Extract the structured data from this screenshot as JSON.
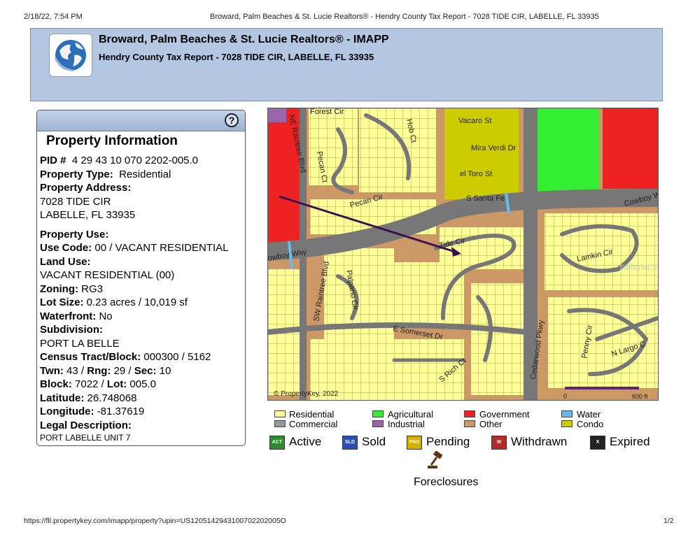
{
  "print_header": {
    "datetime": "2/18/22, 7:54 PM",
    "page_title": "Broward, Palm Beaches & St. Lucie Realtors® - Hendry County Tax Report - 7028 TIDE CIR, LABELLE, FL 33935"
  },
  "banner": {
    "title": "Broward, Palm Beaches & St. Lucie Realtors® - IMAPP",
    "subtitle": "Hendry County Tax Report - 7028 TIDE CIR, LABELLE, FL 33935",
    "background": "#b3c6e2"
  },
  "panel": {
    "help_icon": "?",
    "title": "Property Information",
    "pid_label": "PID #",
    "pid_value": "4 29 43 10 070 2202-005.0",
    "property_type_label": "Property Type:",
    "property_type_value": "Residential",
    "address_label": "Property Address:",
    "address_line1": "7028 TIDE CIR",
    "address_line2": "LABELLE, FL 33935",
    "use_label": "Property Use:",
    "use_code_label": "Use Code:",
    "use_code_value": "00 / VACANT RESIDENTIAL",
    "land_use_label": "Land Use:",
    "land_use_value": "VACANT RESIDENTIAL (00)",
    "zoning_label": "Zoning:",
    "zoning_value": "RG3",
    "lot_size_label": "Lot Size:",
    "lot_size_value": "0.23 acres / 10,019 sf",
    "waterfront_label": "Waterfront:",
    "waterfront_value": "No",
    "subdivision_label": "Subdivision:",
    "subdivision_value": "PORT LA BELLE",
    "census_label": "Census Tract/Block:",
    "census_value": "000300 / 5162",
    "twn_label": "Twn:",
    "twn_value": "43",
    "rng_label": "Rng:",
    "rng_value": "29",
    "sec_label": "Sec:",
    "sec_value": "10",
    "block_label": "Block:",
    "block_value": "7022",
    "lot_label": "Lot:",
    "lot_value": "005.0",
    "latitude_label": "Latitude:",
    "latitude_value": "26.748068",
    "longitude_label": "Longitude:",
    "longitude_value": "-81.37619",
    "legal_label": "Legal Description:",
    "legal_value": "PORT LABELLE UNIT 7"
  },
  "map": {
    "streets": [
      "Forest Cir",
      "Vacaro St",
      "NE Raintree Blvd",
      "Hob Ct",
      "Mira Verdi Dr",
      "Pecan Ct",
      "el Toro St",
      "Pecan Cir",
      "S Santa Fe",
      "Cowboy W",
      "Tide Cir",
      "owboy Way",
      "Lamkin Cir",
      "SW Raintree Blvd",
      "Palpano Cir",
      "E Somerset Dr",
      "Cedarwood Pkwy",
      "Penny Cir",
      "N Largo C",
      "S Rich Ct"
    ],
    "copyright": "© PropertyKey, 2022",
    "scale_zero": "0",
    "scale_max": "600 ft",
    "watermark": "StellarMLS",
    "colors": {
      "residential": "#ffff99",
      "commercial": "#999999",
      "agricultural": "#33ee33",
      "industrial": "#9966aa",
      "government": "#ee2222",
      "other": "#cc9966",
      "water": "#66bbee",
      "condo": "#cccc00",
      "road": "#777777"
    }
  },
  "legend": [
    {
      "label": "Residential",
      "color": "#ffff99"
    },
    {
      "label": "Commercial",
      "color": "#999999"
    },
    {
      "label": "Agricultural",
      "color": "#33ee33"
    },
    {
      "label": "Industrial",
      "color": "#9966aa"
    },
    {
      "label": "Government",
      "color": "#ee2222"
    },
    {
      "label": "Other",
      "color": "#cc9966"
    },
    {
      "label": "Water",
      "color": "#66bbee"
    },
    {
      "label": "Condo",
      "color": "#cccc00"
    }
  ],
  "statuses": [
    {
      "code": "ACT",
      "label": "Active",
      "color": "#2e8b2e"
    },
    {
      "code": "SLD",
      "label": "Sold",
      "color": "#2a4fb5"
    },
    {
      "code": "PND",
      "label": "Pending",
      "color": "#d4b000"
    },
    {
      "code": "W",
      "label": "Withdrawn",
      "color": "#b52a2a"
    },
    {
      "code": "X",
      "label": "Expired",
      "color": "#222222"
    }
  ],
  "foreclosures_label": "Foreclosures",
  "footer": {
    "url": "https://fll.propertykey.com/imapp/property?upin=US1205142943100702202005O",
    "page": "1/2"
  }
}
